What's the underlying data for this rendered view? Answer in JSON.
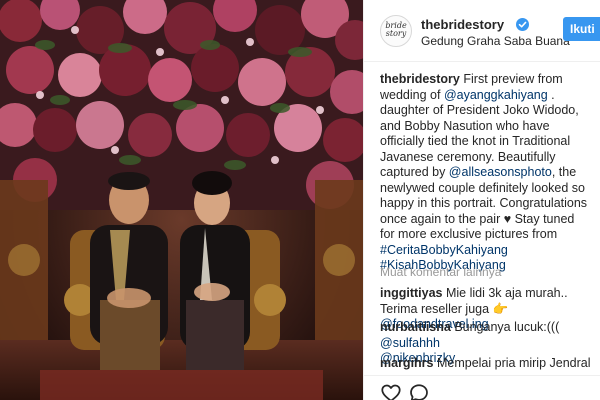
{
  "post": {
    "username": "thebridestory",
    "avatar_text": "bride story",
    "location": "Gedung Graha Saba Buana",
    "follow_label": "Ikuti"
  },
  "caption": {
    "username": "thebridestory",
    "text_1": "First preview from wedding of ",
    "mention_1": "@ayanggkahiyang",
    "text_2": " . daughter of President Joko Widodo, and Bobby Nasution who have officially tied the knot in Traditional Javanese ceremony. Beautifully captured by ",
    "mention_2": "@allseasonsphoto",
    "text_3": ", the newlywed couple definitely looked so happy in this portrait. Congratulations once again to the pair ",
    "heart": "♥",
    "text_4": " Stay tuned for more exclusive pictures from",
    "hashtag_1": "#CeritaBobbyKahiyang",
    "hashtag_2": "#KisahBobbyKahiyang"
  },
  "load_more_label": "Muat komentar lainnya",
  "comments": [
    {
      "username": "inggittiyas",
      "text": " Mie lidi 3k aja murah.. Terima reseller juga ",
      "emoji": "👉",
      "mention": "@foodandtravel.ing"
    },
    {
      "username": "nurbaitiisna",
      "text": " Bunganya lucuk:((( ",
      "mention": "@sulfahhh",
      "mention_2": "@nikenbrizky"
    },
    {
      "username": "margihrs",
      "text": " Mempelai pria mirip Jendral"
    }
  ],
  "icons": {
    "verified": "verified-badge-icon",
    "like": "heart-icon",
    "comment": "comment-bubble-icon"
  },
  "colors": {
    "accent": "#3897f0",
    "link": "#003569",
    "muted": "#999999",
    "border": "#efefef"
  }
}
